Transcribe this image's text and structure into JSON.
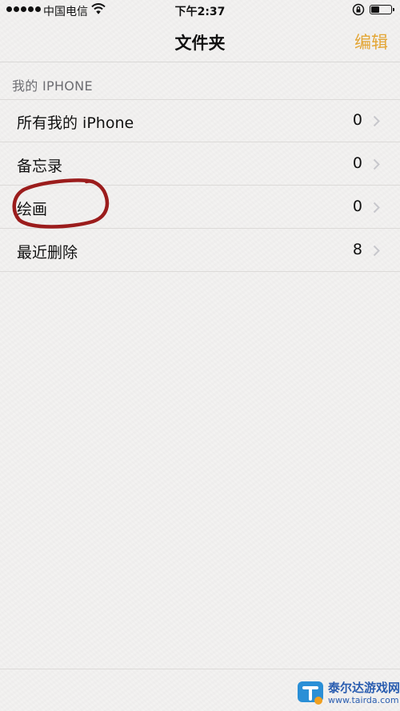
{
  "status_bar": {
    "carrier": "中国电信",
    "time": "下午2:37"
  },
  "nav": {
    "title": "文件夹",
    "edit_label": "编辑",
    "accent_color": "#e3a534"
  },
  "section": {
    "header": "我的 IPHONE"
  },
  "folders": [
    {
      "label": "所有我的 iPhone",
      "count": "0"
    },
    {
      "label": "备忘录",
      "count": "0"
    },
    {
      "label": "绘画",
      "count": "0"
    },
    {
      "label": "最近删除",
      "count": "8"
    }
  ],
  "annotation": {
    "shape": "hand-drawn circle",
    "color": "#9b1c1c",
    "target": "绘画"
  },
  "watermark": {
    "name": "泰尔达游戏网",
    "url": "www.tairda.com"
  }
}
